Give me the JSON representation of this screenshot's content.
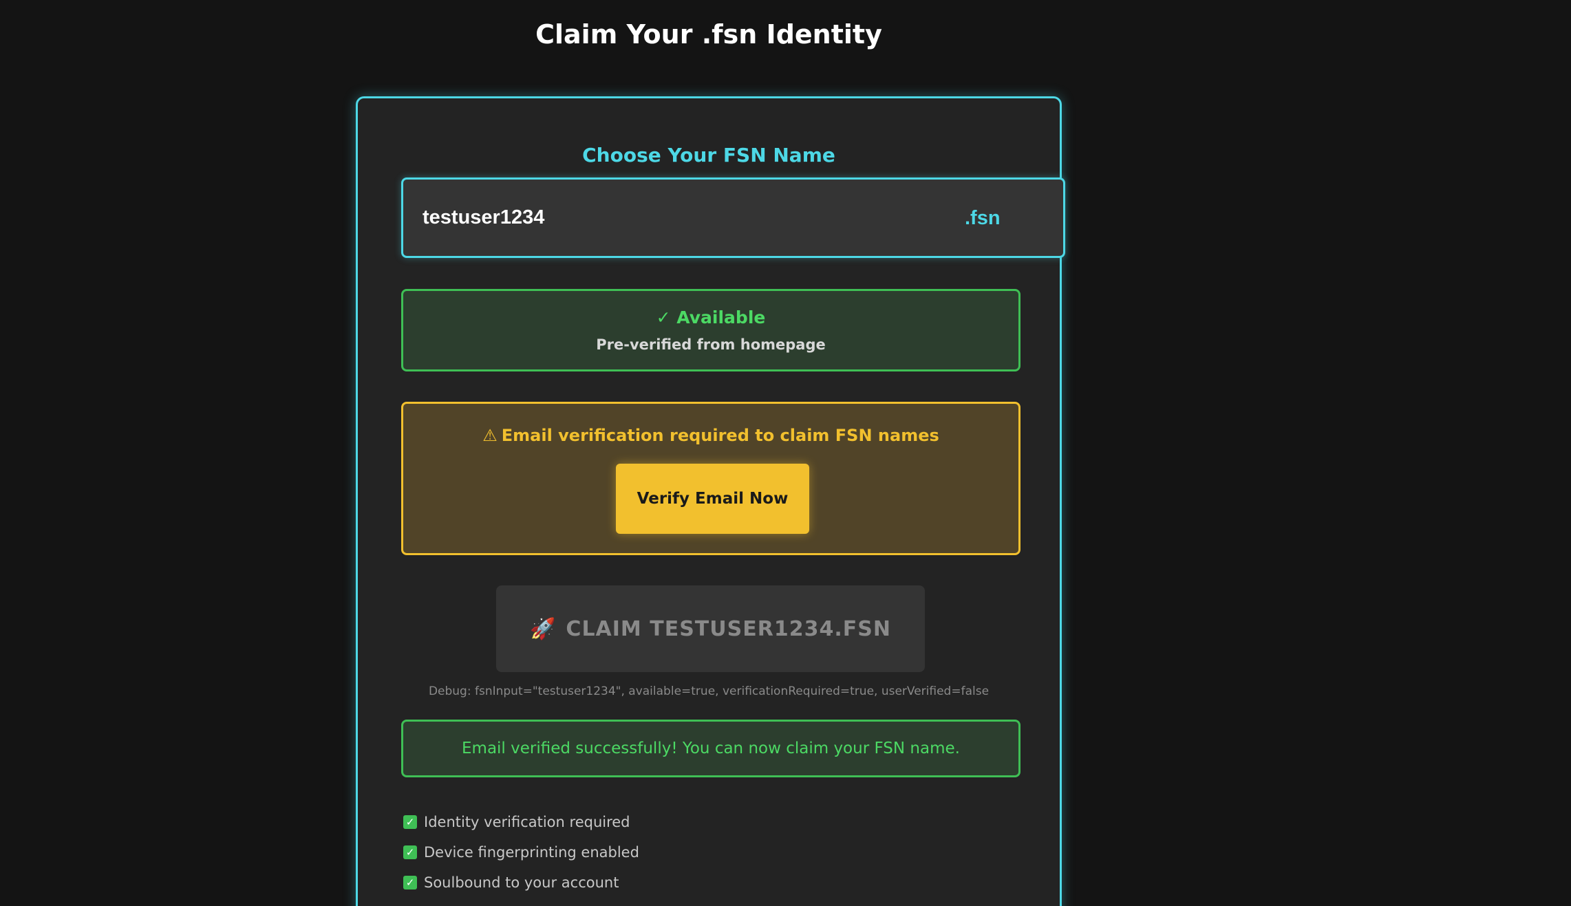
{
  "page": {
    "title": "Claim Your .fsn Identity"
  },
  "name_section": {
    "label": "Choose Your FSN Name",
    "input_value": "testuser1234",
    "suffix": ".fsn"
  },
  "availability": {
    "status": "✓ Available",
    "detail": "Pre-verified from homepage",
    "color": "#4cd964"
  },
  "warning": {
    "icon": "warning-icon",
    "message": "Email verification required to claim FSN names",
    "button_label": "Verify Email Now",
    "color": "#f2c02e"
  },
  "claim": {
    "icon": "rocket-icon",
    "button_label": "CLAIM TESTUSER1234.FSN"
  },
  "debug_text": "Debug: fsnInput=\"testuser1234\", available=true, verificationRequired=true, userVerified=false",
  "success_message": "Email verified successfully! You can now claim your FSN name.",
  "checklist": [
    "Identity verification required",
    "Device fingerprinting enabled",
    "Soulbound to your account"
  ],
  "colors": {
    "accent": "#4dd8e6",
    "success": "#3fbf55",
    "warning": "#f2c02e",
    "background": "#141414"
  }
}
